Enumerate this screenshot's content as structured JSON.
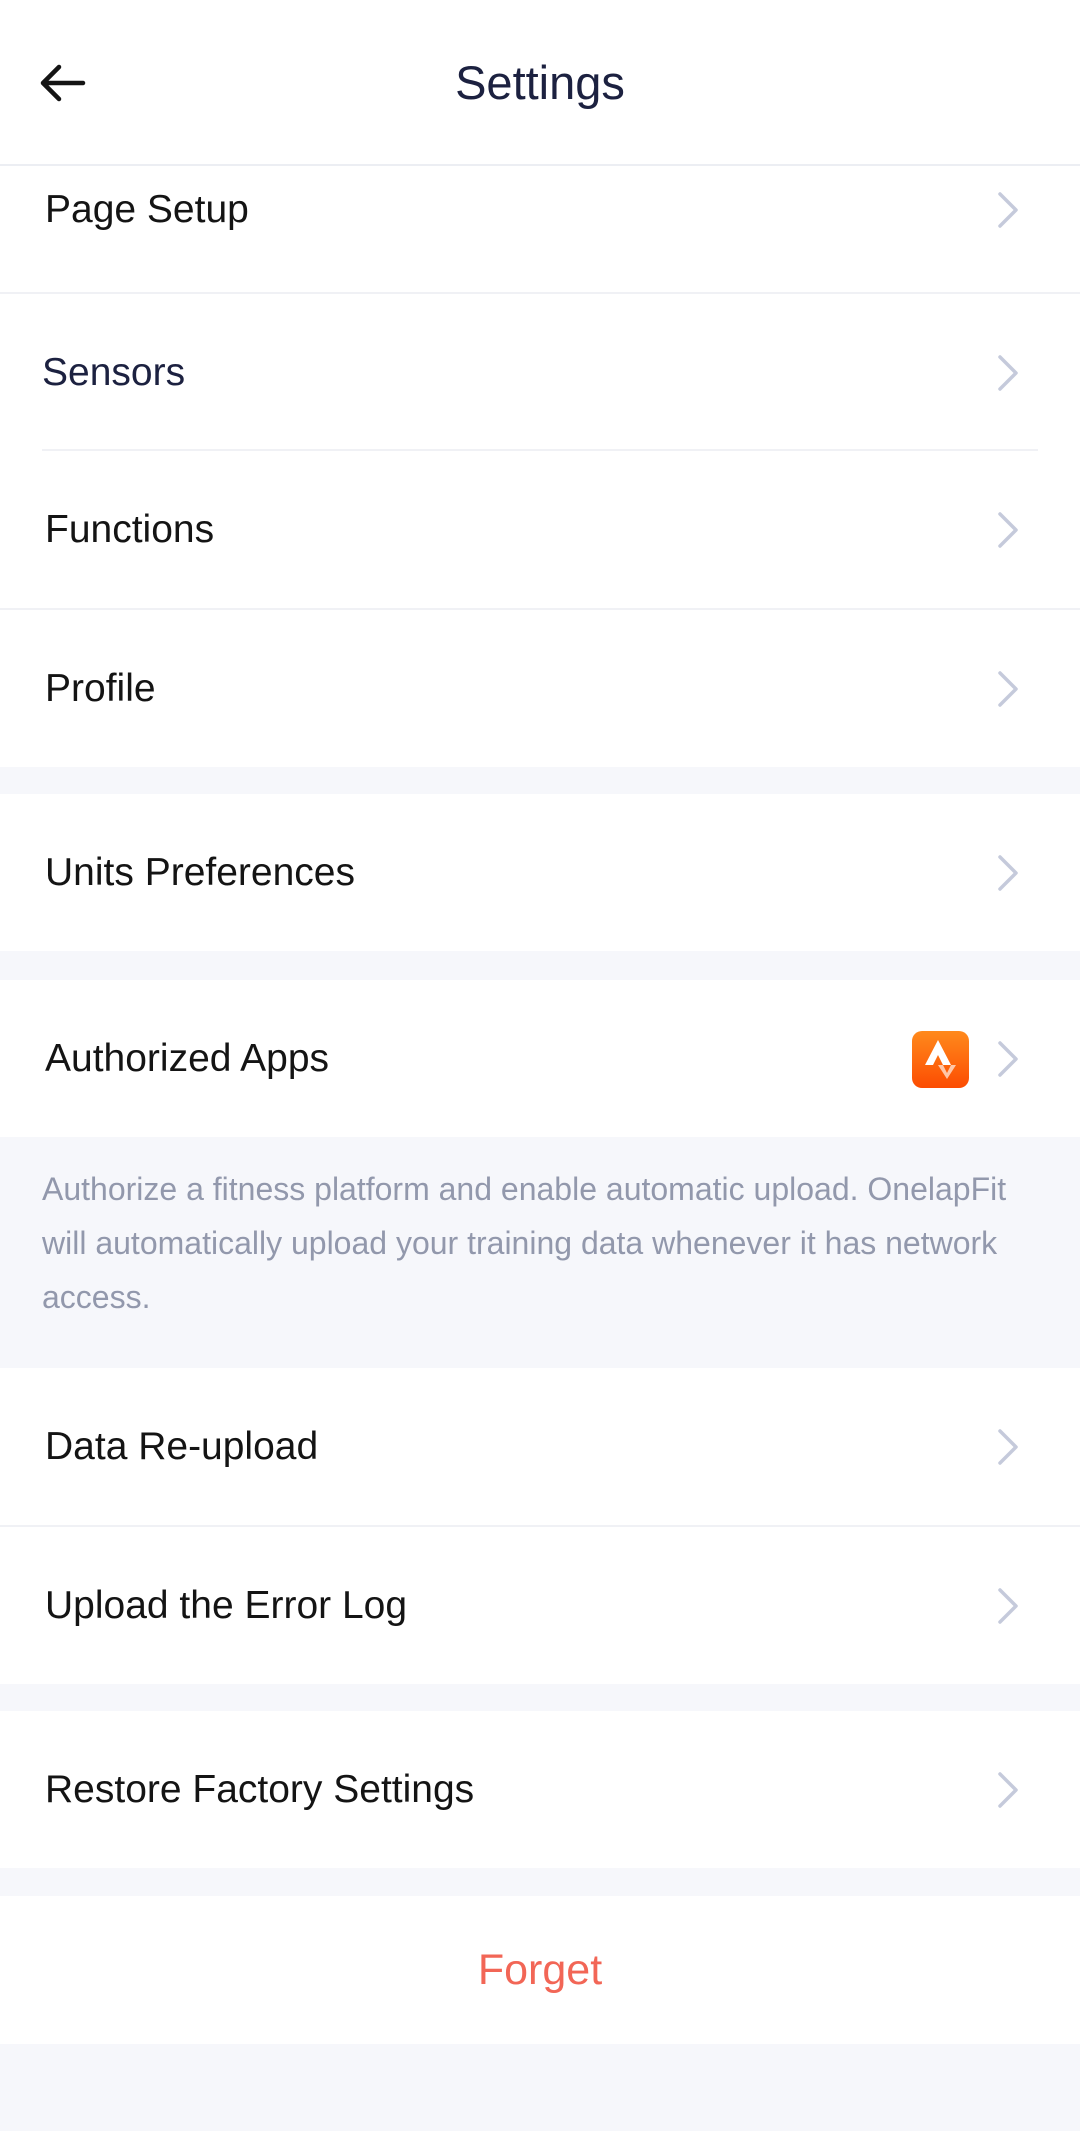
{
  "header": {
    "title": "Settings",
    "back_icon": "arrow-left-icon"
  },
  "rows": {
    "page_setup": "Page Setup",
    "sensors": "Sensors",
    "functions": "Functions",
    "profile": "Profile",
    "units_preferences": "Units Preferences",
    "authorized_apps": "Authorized Apps",
    "data_reupload": "Data Re-upload",
    "upload_error_log": "Upload the Error Log",
    "restore_factory": "Restore Factory Settings"
  },
  "authorized_apps": {
    "app_icon": "strava-icon",
    "app_color": "#fc4c02"
  },
  "info": {
    "authorize_text": "Authorize a fitness platform and enable automatic upload. OnelapFit will automatically upload your training data whenever it has network access."
  },
  "forget": {
    "label": "Forget",
    "color": "#f26656"
  },
  "icons": {
    "chevron": "chevron-right-icon"
  },
  "colors": {
    "background": "#f6f7fb",
    "title": "#1c2140",
    "chevron": "#c5cadb"
  }
}
